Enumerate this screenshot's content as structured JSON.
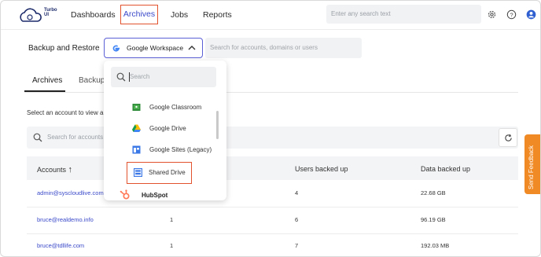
{
  "app": {
    "logo_text": "Turbo UI"
  },
  "nav": {
    "items": [
      "Dashboards",
      "Archives",
      "Jobs",
      "Reports"
    ]
  },
  "top_search": {
    "placeholder": "Enter any search text"
  },
  "backup": {
    "label": "Backup and Restore",
    "dropdown_value": "Google Workspace",
    "account_search_placeholder": "Search for accounts, domains or users"
  },
  "tabs": [
    "Archives",
    "Backup"
  ],
  "select_text": "Select an account to view a",
  "filter": {
    "placeholder": "Search for accounts"
  },
  "table": {
    "headers": [
      "Accounts",
      "Users backed up",
      "Data backed up"
    ],
    "rows": [
      {
        "account": "admin@syscloudlive.com",
        "col2": "",
        "users": "4",
        "data": "22.68 GB"
      },
      {
        "account": "bruce@realdemo.info",
        "col2": "1",
        "users": "6",
        "data": "96.19 GB"
      },
      {
        "account": "bruce@tdllife.com",
        "col2": "1",
        "users": "7",
        "data": "192.03 MB"
      }
    ]
  },
  "menu": {
    "search_placeholder": "Search",
    "items": [
      {
        "label": "Google Classroom",
        "icon": "classroom-icon",
        "color": "#2e8b3a"
      },
      {
        "label": "Google Drive",
        "icon": "drive-icon",
        "color": "#1a73e8"
      },
      {
        "label": "Google Sites (Legacy)",
        "icon": "sites-icon",
        "color": "#3b78e7"
      },
      {
        "label": "Shared Drive",
        "icon": "shared-drive-icon",
        "color": "#3b78e7"
      },
      {
        "label": "HubSpot",
        "icon": "hubspot-icon",
        "color": "#ff7a59"
      }
    ]
  },
  "feedback": {
    "label": "Send Feedback"
  },
  "colors": {
    "accent": "#3a49c9",
    "highlight": "#e2532d",
    "feedback": "#f08a24"
  }
}
